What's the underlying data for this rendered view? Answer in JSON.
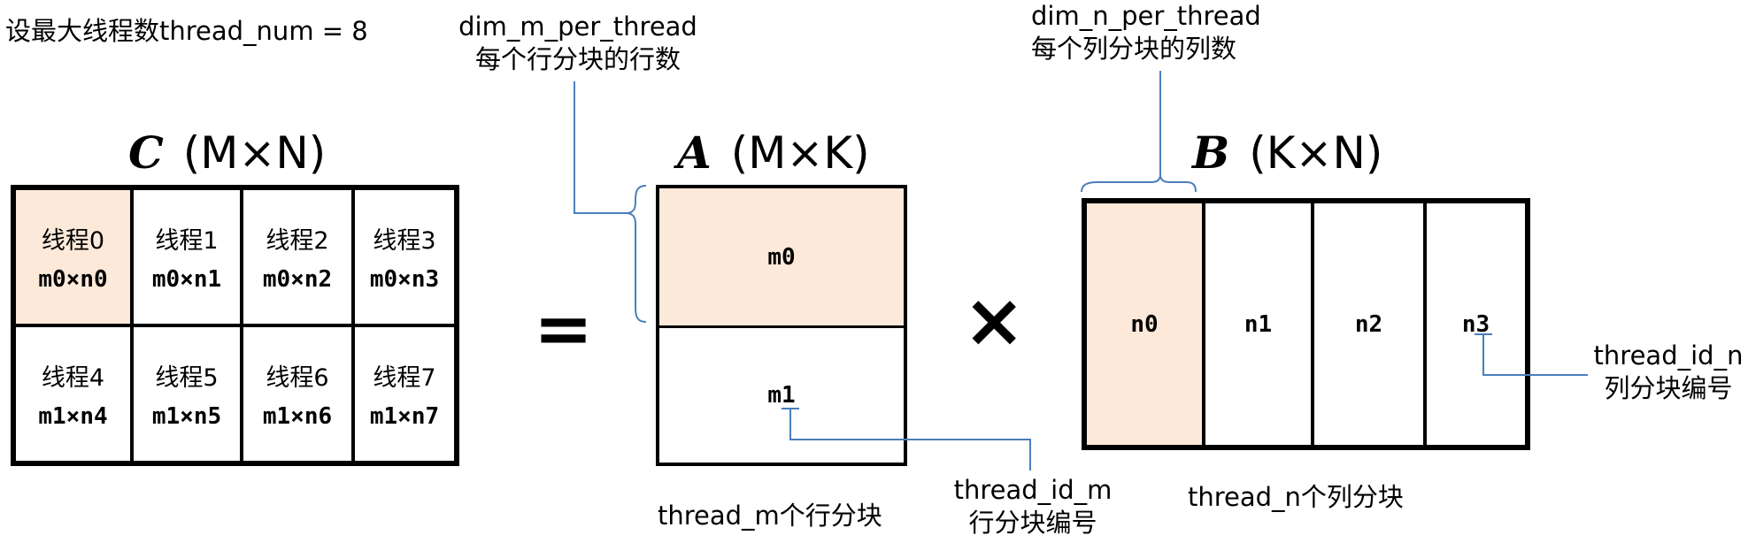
{
  "header_note": "设最大线程数thread_num = 8",
  "colors": {
    "highlight": "#fde9d9",
    "annotation": "#4a7ebb"
  },
  "matrix_c": {
    "symbol": "C",
    "dims": "(M×N)",
    "cells": [
      {
        "thread": "线程0",
        "block": "m0×n0",
        "highlight": true
      },
      {
        "thread": "线程1",
        "block": "m0×n1"
      },
      {
        "thread": "线程2",
        "block": "m0×n2"
      },
      {
        "thread": "线程3",
        "block": "m0×n3"
      },
      {
        "thread": "线程4",
        "block": "m1×n4"
      },
      {
        "thread": "线程5",
        "block": "m1×n5"
      },
      {
        "thread": "线程6",
        "block": "m1×n6"
      },
      {
        "thread": "线程7",
        "block": "m1×n7"
      }
    ]
  },
  "equals": "=",
  "times": "×",
  "matrix_a": {
    "symbol": "A",
    "dims": "(M×K)",
    "rows": [
      "m0",
      "m1"
    ],
    "caption": "thread_m个行分块"
  },
  "matrix_b": {
    "symbol": "B",
    "dims": "(K×N)",
    "cols": [
      "n0",
      "n1",
      "n2",
      "n3"
    ],
    "caption": "thread_n个列分块"
  },
  "annotations": {
    "dim_m": {
      "line1": "dim_m_per_thread",
      "line2": "每个行分块的行数"
    },
    "dim_n": {
      "line1": "dim_n_per_thread",
      "line2": "每个列分块的列数"
    },
    "id_m": {
      "line1": "thread_id_m",
      "line2": "行分块编号"
    },
    "id_n": {
      "line1": "thread_id_n",
      "line2": "列分块编号"
    }
  }
}
